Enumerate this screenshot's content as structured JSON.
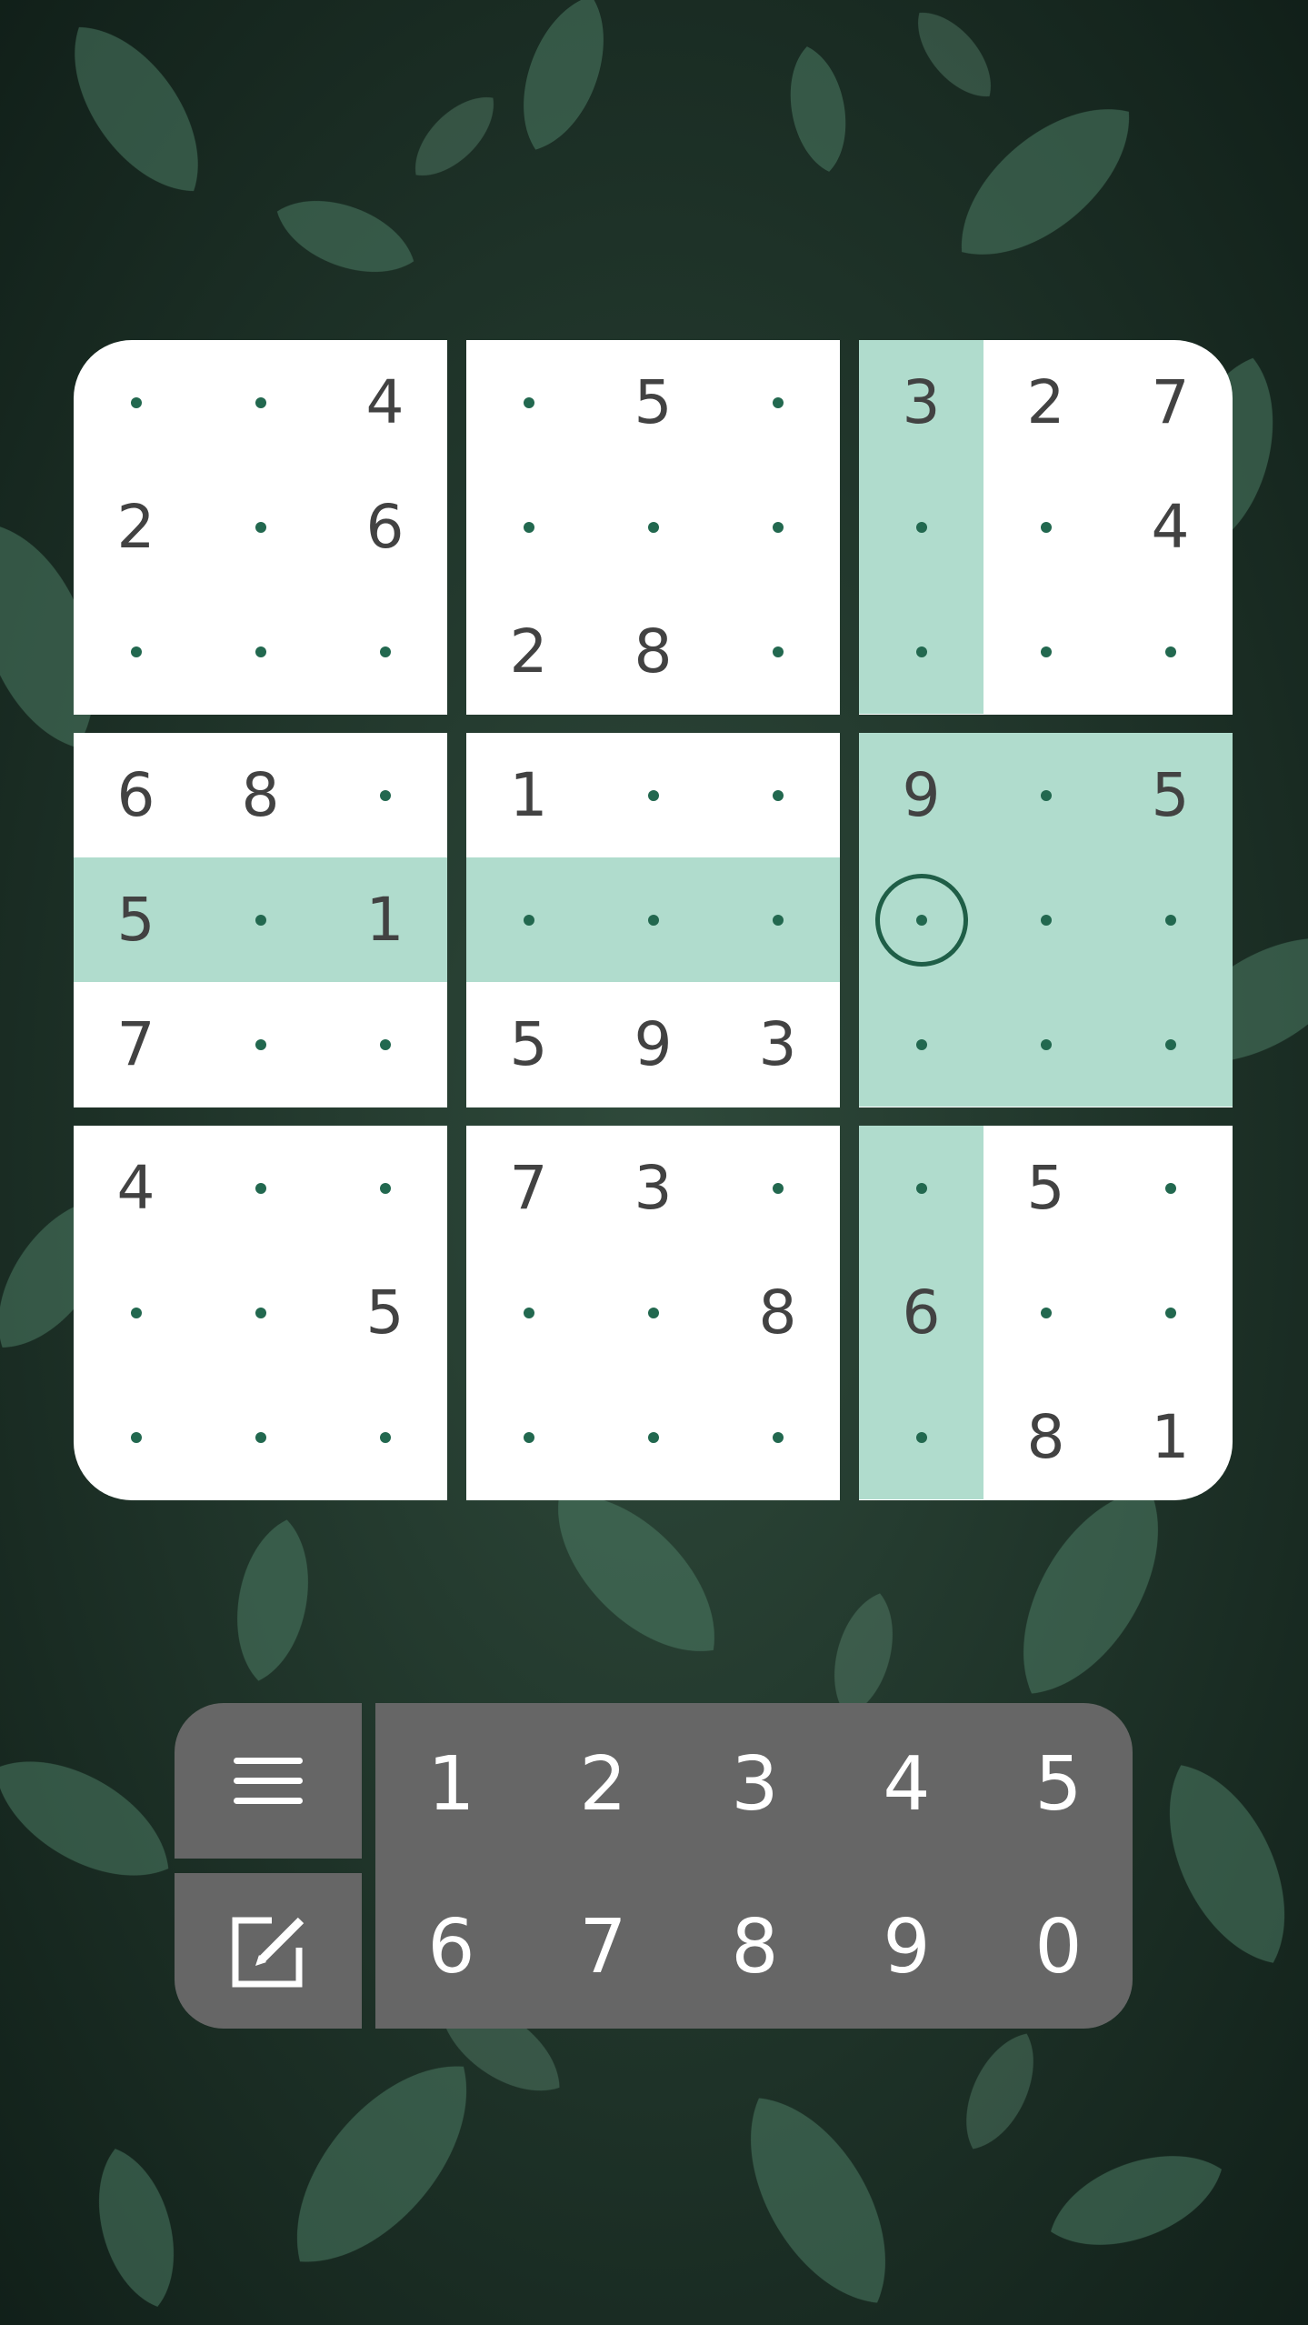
{
  "app": {
    "name": "Sudoku",
    "background": "leafy-foliage",
    "colors": {
      "board_cell": "#ffffff",
      "highlight": "#b0dccd",
      "dot": "#22684f",
      "digit": "#424242",
      "keypad": "#666666",
      "keypad_text": "#ffffff"
    }
  },
  "board": {
    "rows": [
      [
        "",
        "",
        "4",
        "",
        "5",
        "",
        "3",
        "2",
        "7"
      ],
      [
        "2",
        "",
        "6",
        "",
        "",
        "",
        "",
        "",
        "4"
      ],
      [
        "",
        "",
        "",
        "2",
        "8",
        "",
        "",
        "",
        ""
      ],
      [
        "6",
        "8",
        "",
        "1",
        "",
        "",
        "9",
        "",
        "5"
      ],
      [
        "5",
        "",
        "1",
        "",
        "",
        "",
        "",
        "",
        ""
      ],
      [
        "7",
        "",
        "",
        "5",
        "9",
        "3",
        "",
        "",
        ""
      ],
      [
        "4",
        "",
        "",
        "7",
        "3",
        "",
        "",
        "5",
        ""
      ],
      [
        "",
        "",
        "5",
        "",
        "",
        "8",
        "6",
        "",
        ""
      ],
      [
        "",
        "",
        "",
        "",
        "",
        "",
        "",
        "8",
        "1"
      ]
    ],
    "selected": {
      "row": 4,
      "col": 6
    },
    "empty_marker": "dot"
  },
  "keypad": {
    "digits": [
      "1",
      "2",
      "3",
      "4",
      "5",
      "6",
      "7",
      "8",
      "9",
      "0"
    ],
    "menu_icon": "menu-icon",
    "edit_icon": "edit-notes-icon"
  }
}
